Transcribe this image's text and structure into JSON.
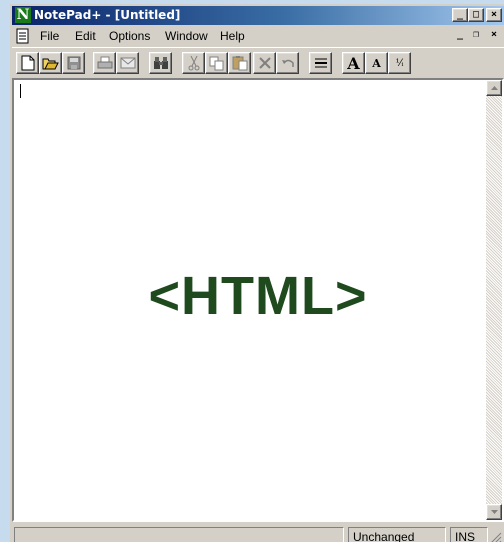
{
  "window": {
    "title": "NotePad+ - [Untitled]",
    "app_icon_letter": "N"
  },
  "titlebar_buttons": {
    "minimize": "_",
    "maximize": "□",
    "close": "×"
  },
  "menu": {
    "items": [
      {
        "label": "File"
      },
      {
        "label": "Edit"
      },
      {
        "label": "Options"
      },
      {
        "label": "Window"
      },
      {
        "label": "Help"
      }
    ],
    "mdi_buttons": {
      "minimize": "_",
      "restore": "❐",
      "close": "×"
    }
  },
  "toolbar": {
    "buttons": [
      {
        "icon": "new-file-icon"
      },
      {
        "icon": "open-folder-icon"
      },
      {
        "icon": "save-icon"
      },
      {
        "icon": "print-icon"
      },
      {
        "icon": "email-icon"
      },
      {
        "icon": "find-binoculars-icon"
      },
      {
        "icon": "cut-scissors-icon"
      },
      {
        "icon": "copy-icon"
      },
      {
        "icon": "paste-icon"
      },
      {
        "icon": "delete-icon"
      },
      {
        "icon": "undo-icon"
      },
      {
        "icon": "word-wrap-icon"
      },
      {
        "icon": "font-larger-icon"
      },
      {
        "icon": "font-smaller-icon"
      },
      {
        "icon": "superscript-icon"
      }
    ],
    "font_larger_glyph": "A",
    "font_smaller_glyph": "A",
    "superscript_glyph": "¹⁄ᵢ"
  },
  "editor": {
    "content": "<HTML>"
  },
  "status": {
    "main": "",
    "modified": "Unchanged",
    "mode": "INS"
  },
  "colors": {
    "title_gradient_start": "#0a246a",
    "title_gradient_end": "#a6caf0",
    "content_text": "#1e4a1e",
    "background": "#c6dcee"
  }
}
